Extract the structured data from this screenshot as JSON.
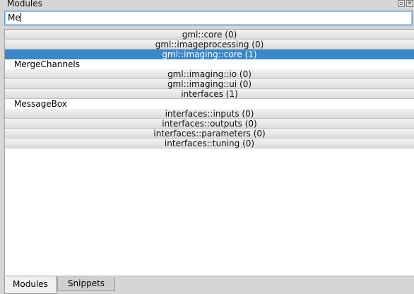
{
  "panel": {
    "title": "Modules",
    "float_icon": "float-icon",
    "close_icon": "close-icon"
  },
  "search": {
    "value": "Me"
  },
  "list": {
    "rows": [
      {
        "kind": "category",
        "label": "gml::core (0)",
        "selected": false
      },
      {
        "kind": "category",
        "label": "gml::imageprocessing (0)",
        "selected": false
      },
      {
        "kind": "category",
        "label": "gml::imaging::core (1)",
        "selected": true
      },
      {
        "kind": "item",
        "label": "MergeChannels"
      },
      {
        "kind": "category",
        "label": "gml::imaging::io (0)",
        "selected": false
      },
      {
        "kind": "category",
        "label": "gml::imaging::ui (0)",
        "selected": false
      },
      {
        "kind": "category",
        "label": "interfaces (1)",
        "selected": false
      },
      {
        "kind": "item",
        "label": "MessageBox"
      },
      {
        "kind": "category",
        "label": "interfaces::inputs (0)",
        "selected": false
      },
      {
        "kind": "category",
        "label": "interfaces::outputs (0)",
        "selected": false
      },
      {
        "kind": "category",
        "label": "interfaces::parameters (0)",
        "selected": false
      },
      {
        "kind": "category",
        "label": "interfaces::tuning (0)",
        "selected": false
      }
    ]
  },
  "tabs": {
    "modules_label": "Modules",
    "snippets_label": "Snippets",
    "active": "Modules"
  },
  "colors": {
    "selection": "#3a87c9",
    "focus_border": "#5a9ad0"
  }
}
